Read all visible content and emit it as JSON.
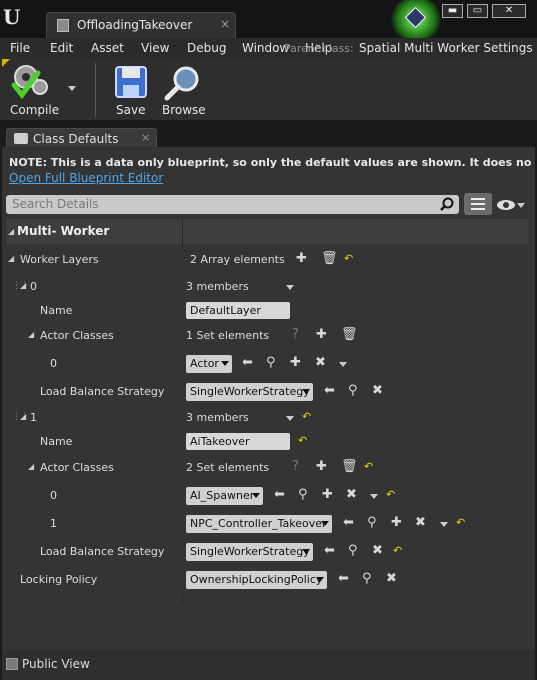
{
  "window": {
    "tab_title": "OffloadingTakeover",
    "close": "×",
    "min": "▬",
    "max": "▭",
    "exit": "✕"
  },
  "menu": {
    "items": [
      "File",
      "Edit",
      "Asset",
      "View",
      "Debug",
      "Window",
      "Help"
    ],
    "parent_label": "Parent class:",
    "parent_value": "Spatial Multi Worker Settings"
  },
  "toolbar": {
    "compile": "Compile",
    "save": "Save",
    "browse": "Browse"
  },
  "details": {
    "tab": "Class Defaults",
    "tab_close": "×",
    "note": "NOTE: This is a data only blueprint, so only the default values are shown.  It does not have any scri",
    "link": "Open Full Blueprint Editor",
    "search_placeholder": "Search Details",
    "category": "Multi- Worker"
  },
  "props": {
    "worker_layers": "Worker Layers",
    "worker_layers_val": "2 Array elements",
    "i0": "0",
    "members0": "3 members",
    "name_lbl": "Name",
    "name0": "DefaultLayer",
    "actor_classes": "Actor Classes",
    "set0": "1 Set elements",
    "ac0_idx": "0",
    "ac0_val": "Actor",
    "lbs": "Load Balance Strategy",
    "lbs0": "SingleWorkerStrategy",
    "i1": "1",
    "members1": "3 members",
    "name1": "AiTakeover",
    "set1": "2 Set elements",
    "ac1_0_idx": "0",
    "ac1_0_val": "AI_Spawner",
    "ac1_1_idx": "1",
    "ac1_1_val": "NPC_Controller_Takeover",
    "lbs1": "SingleWorkerStrategy",
    "locking": "Locking Policy",
    "locking_val": "OwnershipLockingPolicy"
  },
  "footer": {
    "public_view": "Public View"
  },
  "colors": {
    "link": "#4ea6ea",
    "reset_arrow": "#e8d800",
    "glow": "#7dff6a"
  }
}
